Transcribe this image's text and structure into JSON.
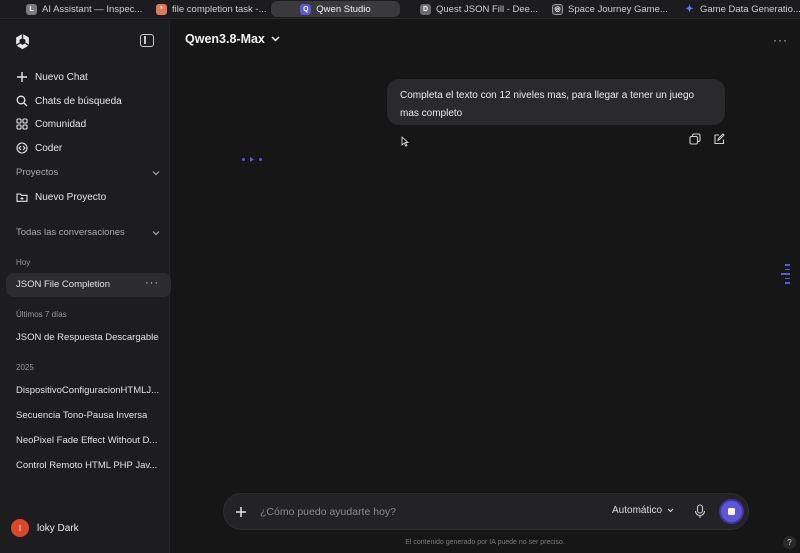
{
  "browser": {
    "tabs": [
      {
        "label": "AI Assistant — Inspec...",
        "icon": "app-icon",
        "color": "#7a7a80",
        "glyph": "L",
        "active": false
      },
      {
        "label": "file completion task -...",
        "icon": "claude-icon",
        "color": "#e0795a",
        "glyph": "*",
        "active": false
      },
      {
        "label": "Qwen Studio",
        "icon": "qwen-icon",
        "color": "#5b57d6",
        "glyph": "Q",
        "active": true
      },
      {
        "label": "Quest JSON Fill - Dee...",
        "icon": "deepseek-icon",
        "color": "#6b6b70",
        "glyph": "D",
        "active": false
      },
      {
        "label": "Space Journey Game...",
        "icon": "openai-icon",
        "color": "#3a3a3d",
        "glyph": "◎",
        "active": false
      },
      {
        "label": "Game Data Generatio...",
        "icon": "gemini-icon",
        "color": "#4f7cff",
        "glyph": "✦",
        "active": false
      }
    ]
  },
  "sidebar": {
    "nav": [
      {
        "label": "Nuevo Chat",
        "icon": "plus-icon"
      },
      {
        "label": "Chats de búsqueda",
        "icon": "search-icon"
      },
      {
        "label": "Comunidad",
        "icon": "grid-icon"
      },
      {
        "label": "Coder",
        "icon": "code-icon"
      }
    ],
    "projects_title": "Proyectos",
    "new_project": "Nuevo Proyecto",
    "all_conversations": "Todas las conversaciones",
    "groups": {
      "today": "Hoy",
      "last7": "Últimos 7 días",
      "year": "2025"
    },
    "today_items": [
      "JSON File Completion"
    ],
    "last7_items": [
      "JSON de Respuesta Descargable"
    ],
    "year_items": [
      "DispositivoConfiguracionHTMLJ...",
      "Secuencia Tono-Pausa Inversa",
      "NeoPixel Fade Effect Without D...",
      "Control Remoto HTML PHP Jav..."
    ],
    "user": {
      "initial": "l",
      "name": "loky Dark"
    }
  },
  "main": {
    "model_name": "Qwen3.8-Max",
    "message": "Completa el texto con 12 niveles mas, para llegar a tener un juego mas completo"
  },
  "composer": {
    "placeholder": "¿Cómo puedo ayudarte hoy?",
    "mode": "Automático",
    "disclaimer": "El contenido generado por IA puede no ser preciso.",
    "help": "?"
  },
  "colors": {
    "accent": "#5b57d6",
    "background": "#161617",
    "sidebar": "#1d1d1f"
  }
}
